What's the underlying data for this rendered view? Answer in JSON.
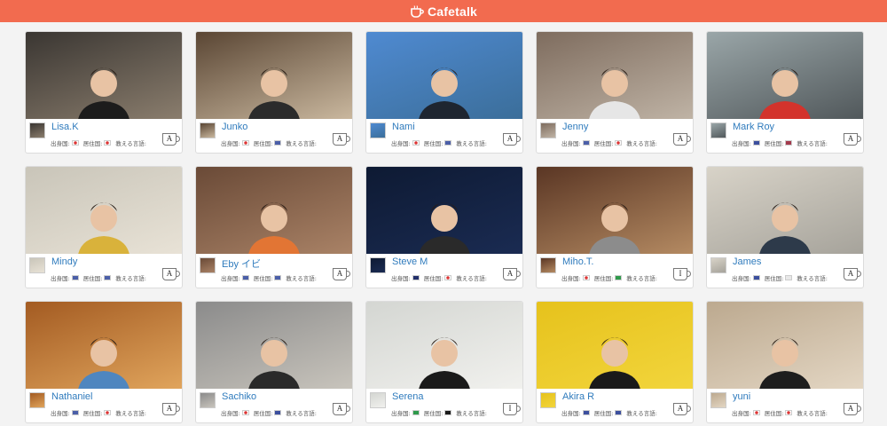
{
  "header": {
    "brand": "Cafetalk"
  },
  "labels": {
    "origin": "出身国:",
    "residence": "居住国:",
    "teaches": "教える言語:"
  },
  "tutors": [
    {
      "name": "Lisa.K",
      "origin": "jp",
      "residence": "jp",
      "lang": "A",
      "bg": [
        "#3a3632",
        "#8a7d6d"
      ],
      "shirt": "#1c1c1c"
    },
    {
      "name": "Junko",
      "origin": "jp",
      "residence": "us",
      "lang": "A",
      "bg": [
        "#5a4634",
        "#c9b79e"
      ],
      "shirt": "#2b2b2b"
    },
    {
      "name": "Nami",
      "origin": "jp",
      "residence": "us",
      "lang": "A",
      "bg": [
        "#4f8ad1",
        "#3b6e9a"
      ],
      "shirt": "#1e2530"
    },
    {
      "name": "Jenny",
      "origin": "us",
      "residence": "jp",
      "lang": "A",
      "bg": [
        "#7e6c5e",
        "#bfb3a5"
      ],
      "shirt": "#e6e6e6"
    },
    {
      "name": "Mark Roy",
      "origin": "gb",
      "residence": "th",
      "lang": "A",
      "bg": [
        "#9aa6a8",
        "#51585b"
      ],
      "shirt": "#d3332c"
    },
    {
      "name": "Mindy",
      "origin": "us",
      "residence": "us",
      "lang": "A",
      "bg": [
        "#c9c5b9",
        "#e8e2d6"
      ],
      "shirt": "#d9b23b"
    },
    {
      "name": "Eby イビ",
      "origin": "us",
      "residence": "us",
      "lang": "A",
      "bg": [
        "#6a4a37",
        "#a98266"
      ],
      "shirt": "#e27534"
    },
    {
      "name": "Steve M",
      "origin": "nz",
      "residence": "jp",
      "lang": "A",
      "bg": [
        "#0e1a33",
        "#1a2b52"
      ],
      "shirt": "#2a2a2a"
    },
    {
      "name": "Miho.T.",
      "origin": "jp",
      "residence": "it",
      "lang": "I",
      "bg": [
        "#5a3624",
        "#b48a62"
      ],
      "shirt": "#8c8c8c"
    },
    {
      "name": "James",
      "origin": "gb",
      "residence": "pl",
      "lang": "A",
      "bg": [
        "#d8d3c8",
        "#a6a39b"
      ],
      "shirt": "#2d3a4a"
    },
    {
      "name": "Nathaniel",
      "origin": "us",
      "residence": "jp",
      "lang": "A",
      "bg": [
        "#a35b22",
        "#e0a45c"
      ],
      "shirt": "#4f86bf"
    },
    {
      "name": "Sachiko",
      "origin": "jp",
      "residence": "gb",
      "lang": "A",
      "bg": [
        "#8b8b8b",
        "#c8c4bc"
      ],
      "shirt": "#2a2a2a"
    },
    {
      "name": "Serena",
      "origin": "it",
      "residence": "de",
      "lang": "I",
      "bg": [
        "#d4d6d2",
        "#f1f1ee"
      ],
      "shirt": "#1a1a1a"
    },
    {
      "name": "Akira R",
      "origin": "gb",
      "residence": "gb",
      "lang": "A",
      "bg": [
        "#e6c21c",
        "#f2d53c"
      ],
      "shirt": "#1a1a1a"
    },
    {
      "name": "yuni",
      "origin": "jp",
      "residence": "kr",
      "lang": "A",
      "bg": [
        "#bca98f",
        "#e3d6c3"
      ],
      "shirt": "#1e1e1e"
    }
  ],
  "flag_colors": {
    "jp": "#ffffff",
    "us": "#4b5fa8",
    "gb": "#3c4f9e",
    "th": "#a33a4c",
    "nz": "#22306b",
    "it": "#2f9a4b",
    "pl": "#e8e8e8",
    "de": "#1a1a1a",
    "kr": "#ffffff"
  }
}
